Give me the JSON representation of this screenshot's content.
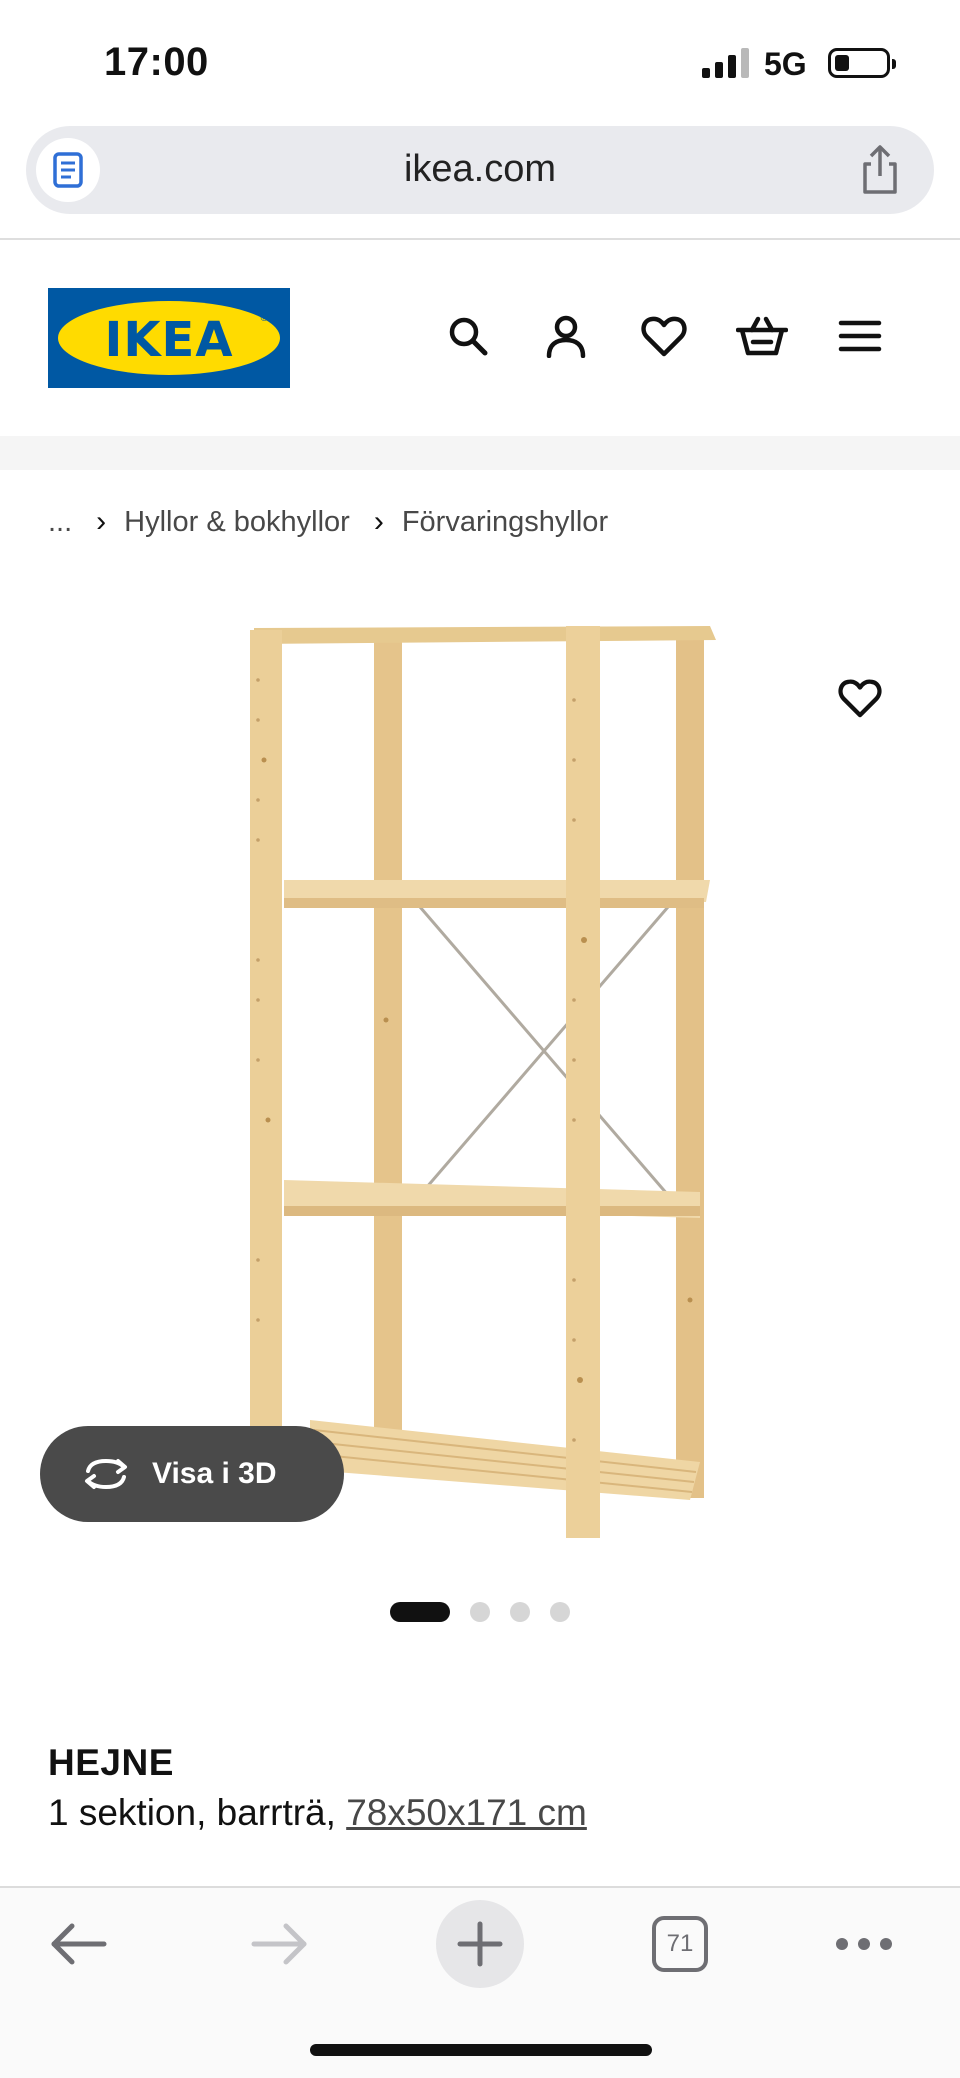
{
  "status_bar": {
    "time": "17:00",
    "network": "5G",
    "signal_bars_active": 3,
    "signal_bars_total": 4,
    "battery_level": 0.2
  },
  "browser": {
    "url": "ikea.com",
    "open_tabs": "71"
  },
  "header": {
    "logo_text": "IKEA",
    "icons": [
      "search-icon",
      "account-icon",
      "heart-icon",
      "basket-icon",
      "menu-icon"
    ]
  },
  "breadcrumb": {
    "ellipsis": "...",
    "items": [
      "Hyllor & bokhyllor",
      "Förvaringshyllor"
    ]
  },
  "gallery": {
    "view_3d_label": "Visa i 3D",
    "image_count": 4,
    "active_index": 0
  },
  "product": {
    "name": "HEJNE",
    "description": "1 sektion, barrträ,",
    "dimensions": "78x50x171 cm"
  },
  "colors": {
    "ikea_blue": "#0058a3",
    "ikea_yellow": "#ffdb00",
    "wood": "#e8c993",
    "button_dark": "#4a4a4a"
  }
}
